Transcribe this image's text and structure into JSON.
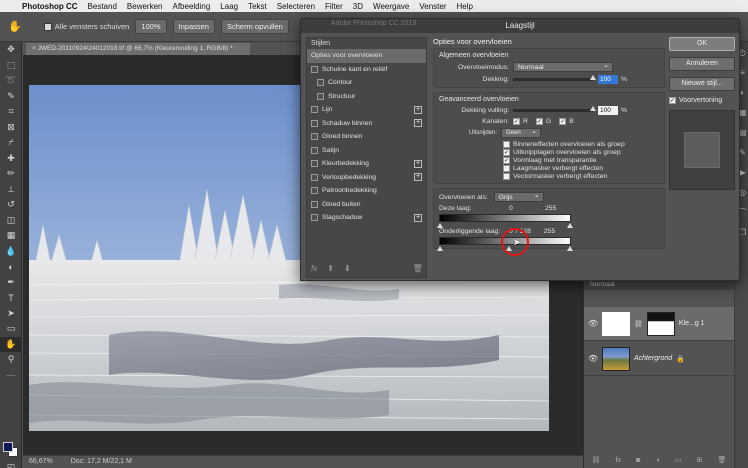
{
  "menubar": {
    "app": "Photoshop CC",
    "items": [
      "Bestand",
      "Bewerken",
      "Afbeelding",
      "Laag",
      "Tekst",
      "Selecteren",
      "Filter",
      "3D",
      "Weergave",
      "Venster",
      "Help"
    ]
  },
  "optionsbar": {
    "all_windows_label": "Alle vensters schuiven",
    "zoom_label": "100%",
    "fit_label": "Inpassen",
    "fill_label": "Scherm opvullen"
  },
  "document": {
    "tab_title": "JWED-20110924\\24012018.tif @ 66,7% (Kleurenvulling 1, RGB/8) *"
  },
  "statusbar": {
    "zoom": "66,67%",
    "doc_info": "Doc: 17,2 M/22,1 M"
  },
  "dialog": {
    "title": "Laagstijl",
    "ghost_title": "Adobe Photoshop CC 2019",
    "styles_header": "Stijlen",
    "styles": [
      {
        "label": "Opties voor overvloeien",
        "selected": true,
        "checkbox": false,
        "plus": false,
        "indent": false
      },
      {
        "label": "Schuine kant en reliëf",
        "selected": false,
        "checkbox": true,
        "plus": false,
        "indent": false
      },
      {
        "label": "Contour",
        "selected": false,
        "checkbox": true,
        "plus": false,
        "indent": true
      },
      {
        "label": "Structuur",
        "selected": false,
        "checkbox": true,
        "plus": false,
        "indent": true
      },
      {
        "label": "Lijn",
        "selected": false,
        "checkbox": true,
        "plus": true,
        "indent": false
      },
      {
        "label": "Schaduw binnen",
        "selected": false,
        "checkbox": true,
        "plus": true,
        "indent": false
      },
      {
        "label": "Gloed binnen",
        "selected": false,
        "checkbox": true,
        "plus": false,
        "indent": false
      },
      {
        "label": "Satijn",
        "selected": false,
        "checkbox": true,
        "plus": false,
        "indent": false
      },
      {
        "label": "Kleurbedekking",
        "selected": false,
        "checkbox": true,
        "plus": true,
        "indent": false
      },
      {
        "label": "Verloopbedekking",
        "selected": false,
        "checkbox": true,
        "plus": true,
        "indent": false
      },
      {
        "label": "Patroonbedekking",
        "selected": false,
        "checkbox": true,
        "plus": false,
        "indent": false
      },
      {
        "label": "Gloed buiten",
        "selected": false,
        "checkbox": true,
        "plus": false,
        "indent": false
      },
      {
        "label": "Slagschaduw",
        "selected": false,
        "checkbox": true,
        "plus": true,
        "indent": false
      }
    ],
    "options": {
      "section_title": "Opties voor overvloeien",
      "general": {
        "title": "Algemeen overvloeien",
        "blend_mode_label": "Overvloeimodus:",
        "blend_mode_value": "Normaal",
        "opacity_label": "Dekking:",
        "opacity_value": "100",
        "opacity_unit": "%"
      },
      "advanced": {
        "title": "Geavanceerd overvloeien",
        "fill_label": "Dekking vulling:",
        "fill_value": "100",
        "fill_unit": "%",
        "channels_label": "Kanalen:",
        "channel_r": "R",
        "channel_g": "G",
        "channel_b": "B",
        "knockout_label": "Uitsnijden:",
        "knockout_value": "Geen",
        "checks": [
          {
            "label": "Binneneffecten overvloeien als groep",
            "checked": false
          },
          {
            "label": "Uitknipplagen overvloeien als groep",
            "checked": true
          },
          {
            "label": "Vormlaag met transparantie",
            "checked": true
          },
          {
            "label": "Laagmasker verbergt effecten",
            "checked": false
          },
          {
            "label": "Vectormasker verbergt effecten",
            "checked": false
          }
        ]
      },
      "blend_if": {
        "label": "Overvloeien als:",
        "value": "Grijs",
        "this_layer_label": "Deze laag:",
        "this_layer_low": "0",
        "this_layer_high": "255",
        "underlying_label": "Onderliggende laag:",
        "underlying_low": "0",
        "underlying_split": "/ 128",
        "underlying_high": "255"
      }
    },
    "buttons": {
      "ok": "OK",
      "cancel": "Annuleren",
      "new_style": "Nieuwe stijl...",
      "preview": "Voorvertoning"
    }
  },
  "layers_panel": {
    "tab_label": "Normaal",
    "layers": [
      {
        "name": "Kle...g 1"
      },
      {
        "name": "Achtergrond"
      }
    ]
  }
}
